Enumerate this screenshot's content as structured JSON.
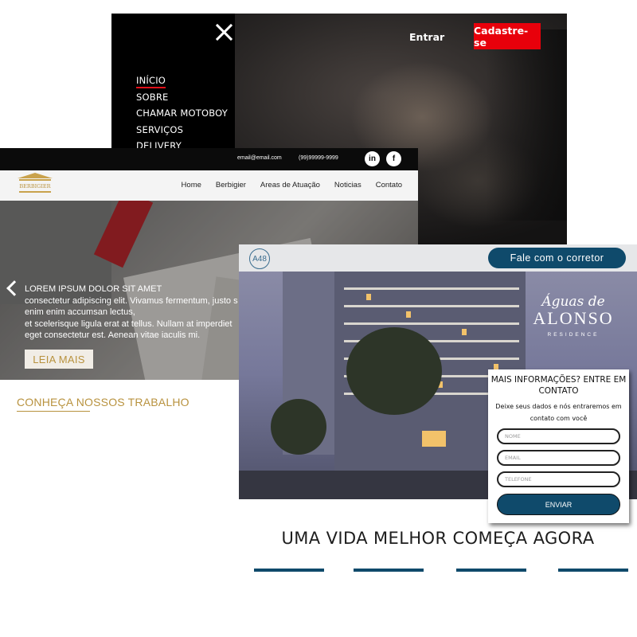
{
  "motoboy_site": {
    "menu": {
      "items": [
        "INÍCIO",
        "SOBRE",
        "CHAMAR MOTOBOY",
        "SERVIÇOS",
        "DELIVERY"
      ]
    },
    "header": {
      "login_label": "Entrar",
      "signup_label": "Cadastre-se"
    },
    "colors": {
      "accent": "#e8000b",
      "menu_bg": "#000000"
    }
  },
  "law_site": {
    "topbar": {
      "email": "email@email.com",
      "phone": "(99)99999-9999",
      "social_icons": [
        "linkedin-icon",
        "facebook-icon"
      ],
      "social_glyphs": [
        "in",
        "f"
      ]
    },
    "logo_text": "BERBIGIER",
    "nav": [
      "Home",
      "Berbigier",
      "Areas de Atuação",
      "Noticias",
      "Contato"
    ],
    "hero": {
      "caption_lines": [
        "LOREM IPSUM DOLOR SIT AMET",
        "consectetur adipiscing elit. Vivamus fermentum, justo s",
        "enim enim accumsan lectus,",
        "et scelerisque ligula erat at tellus. Nullam at imperdiet",
        "eget consectetur est. Aenean vitae iaculis mi."
      ],
      "button_label": "LEIA MAIS"
    },
    "section_title": "CONHEÇA NOSSOS TRABALHO",
    "colors": {
      "gold": "#b8923e",
      "topbar": "#0b0b0b"
    }
  },
  "realty_site": {
    "logo_text": "A48",
    "cta_label": "Fale com o corretor",
    "brand": {
      "line1": "Águas de",
      "line2": "ALONSO",
      "line3": "RESIDENCE"
    },
    "form": {
      "title": "MAIS INFORMAÇÕES? ENTRE EM CONTATO",
      "subtitle": "Deixe seus dados e nós entraremos em contato com você",
      "fields": [
        {
          "placeholder": "NOME"
        },
        {
          "placeholder": "EMAIL"
        },
        {
          "placeholder": "TELEFONE"
        }
      ],
      "submit_label": "ENVIAR"
    },
    "tagline": "UMA VIDA MELHOR COMEÇA AGORA",
    "colors": {
      "primary": "#0f4a6b"
    }
  }
}
